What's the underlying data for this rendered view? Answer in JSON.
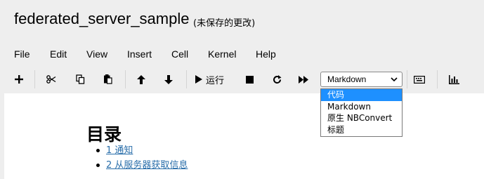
{
  "header": {
    "notebook_name": "federated_server_sample",
    "save_status": "(未保存的更改)"
  },
  "menu": {
    "items": [
      "File",
      "Edit",
      "View",
      "Insert",
      "Cell",
      "Kernel",
      "Help"
    ]
  },
  "toolbar": {
    "add_icon": "plus-icon",
    "cut_icon": "scissors-icon",
    "copy_icon": "copy-icon",
    "paste_icon": "paste-icon",
    "move_up_icon": "arrow-up-icon",
    "move_down_icon": "arrow-down-icon",
    "run_icon": "play-icon",
    "run_label": "运行",
    "stop_icon": "stop-icon",
    "restart_icon": "refresh-icon",
    "run_all_icon": "fast-forward-icon",
    "keyboard_icon": "keyboard-icon",
    "chart_icon": "bar-chart-icon"
  },
  "celltype": {
    "selected": "Markdown",
    "options": [
      "代码",
      "Markdown",
      "原生 NBConvert",
      "标题"
    ],
    "highlighted_option": "代码"
  },
  "notebook": {
    "toc_title": "目录",
    "toc_items": [
      "1  通知",
      "2  从服务器获取信息"
    ]
  },
  "colors": {
    "highlight": "#1e90ff",
    "link": "#296eaa",
    "background": "#eeeeee"
  }
}
